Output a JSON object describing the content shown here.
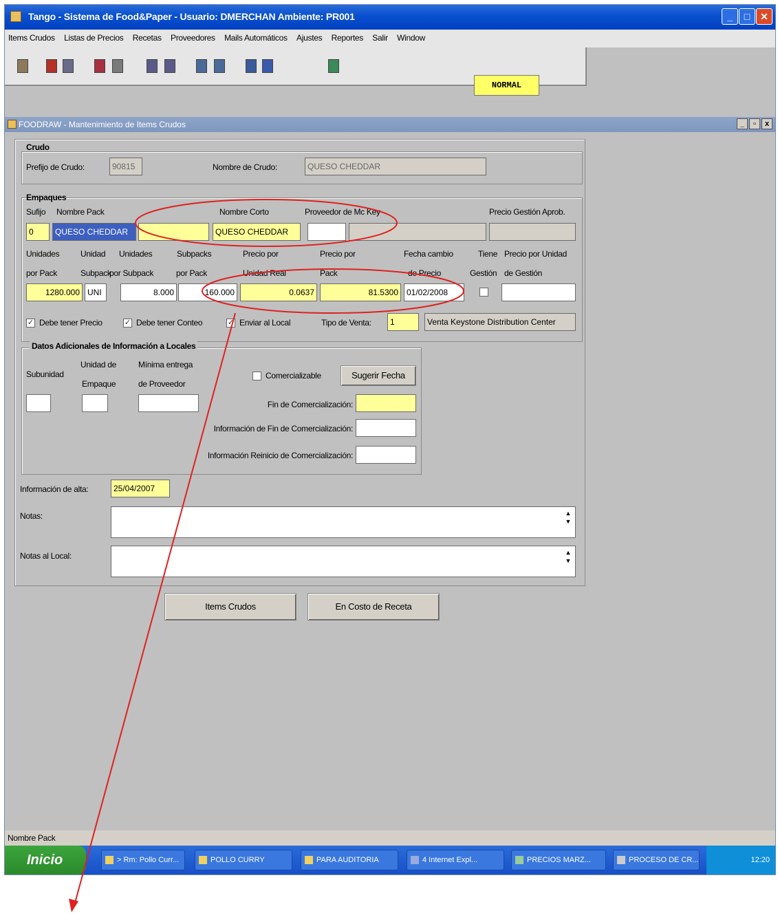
{
  "app": {
    "title": "Tango - Sistema de Food&Paper - Usuario: DMERCHAN Ambiente: PR001",
    "menu": [
      "Items Crudos",
      "Listas de Precios",
      "Recetas",
      "Proveedores",
      "Mails Automáticos",
      "Ajustes",
      "Reportes",
      "Salir",
      "Window"
    ],
    "mode": "NORMAL"
  },
  "child": {
    "title": "FOODRAW - Mantenimiento de Items Crudos"
  },
  "crudo": {
    "heading": "Crudo",
    "prefijo_label": "Prefijo de Crudo:",
    "prefijo_value": "90815",
    "nombre_label": "Nombre de Crudo:",
    "nombre_value": "QUESO CHEDDAR"
  },
  "empaques": {
    "heading": "Empaques",
    "sufijo_label": "Sufijo",
    "nombre_pack_label": "Nombre Pack",
    "nombre_corto_label": "Nombre Corto",
    "proveedor_label": "Proveedor de Mc Key",
    "precio_gestion_label": "Precio Gestión Aprob.",
    "sufijo_value": "0",
    "nombre_pack_value": "QUESO CHEDDAR",
    "nombre_corto_value": "QUESO CHEDDAR",
    "h_unidades_pack": [
      "Unidades",
      "por Pack"
    ],
    "h_unidad_subpack": [
      "Unidad",
      "Subpack"
    ],
    "h_unidades_subpack": [
      "Unidades",
      "por Subpack"
    ],
    "h_subpacks_pack": [
      "Subpacks",
      "por Pack"
    ],
    "h_precio_unidad_real": [
      "Precio por",
      "Unidad Real"
    ],
    "h_precio_pack": [
      "Precio por",
      "Pack"
    ],
    "h_fecha_cambio": [
      "Fecha cambio",
      "de Precio"
    ],
    "h_tiene_gestion": [
      "Tiene",
      "Gestión"
    ],
    "h_precio_unidad_gestion": [
      "Precio por Unidad",
      "de Gestión"
    ],
    "unidades_pack": "1280.000",
    "unidad_subpack": "UNI",
    "unidades_subpack": "8.000",
    "subpacks_pack": "160.000",
    "precio_unidad_real": "0.0637",
    "precio_pack": "81.5300",
    "fecha_cambio": "01/02/2008",
    "chk_debe_precio": "Debe tener Precio",
    "chk_debe_conteo": "Debe tener Conteo",
    "chk_enviar_local": "Enviar al Local",
    "tipo_venta_label": "Tipo de Venta:",
    "tipo_venta_value": "1",
    "tipo_venta_desc": "Venta Keystone Distribution Center"
  },
  "adicionales": {
    "heading": "Datos Adicionales de Información a Locales",
    "subunidad_label": "Subunidad",
    "unidad_empaque_label": [
      "Unidad de",
      "Empaque"
    ],
    "minima_entrega_label": [
      "Mínima entrega",
      "de Proveedor"
    ],
    "comercializable_label": "Comercializable",
    "sugerir_fecha_label": "Sugerir Fecha",
    "fin_label": "Fin de Comercialización:",
    "info_fin_label": "Información de Fin de Comercialización:",
    "info_reinicio_label": "Información Reinicio de Comercialización:"
  },
  "alta": {
    "label": "Información de alta:",
    "value": "25/04/2007"
  },
  "notas": {
    "label": "Notas:",
    "local_label": "Notas al Local:"
  },
  "buttons": {
    "items_crudos": "Items Crudos",
    "costo_receta": "En Costo de Receta"
  },
  "status": "Nombre Pack",
  "taskbar": {
    "start": "Inicio",
    "tasks": [
      "> Rm: Pollo Curr...",
      "POLLO CURRY",
      "PARA AUDITORIA",
      "4 Internet Expl...",
      "PRECIOS MARZ...",
      "PROCESO DE CR..."
    ],
    "clock": "12:20"
  },
  "annotation_color": "#e02020"
}
